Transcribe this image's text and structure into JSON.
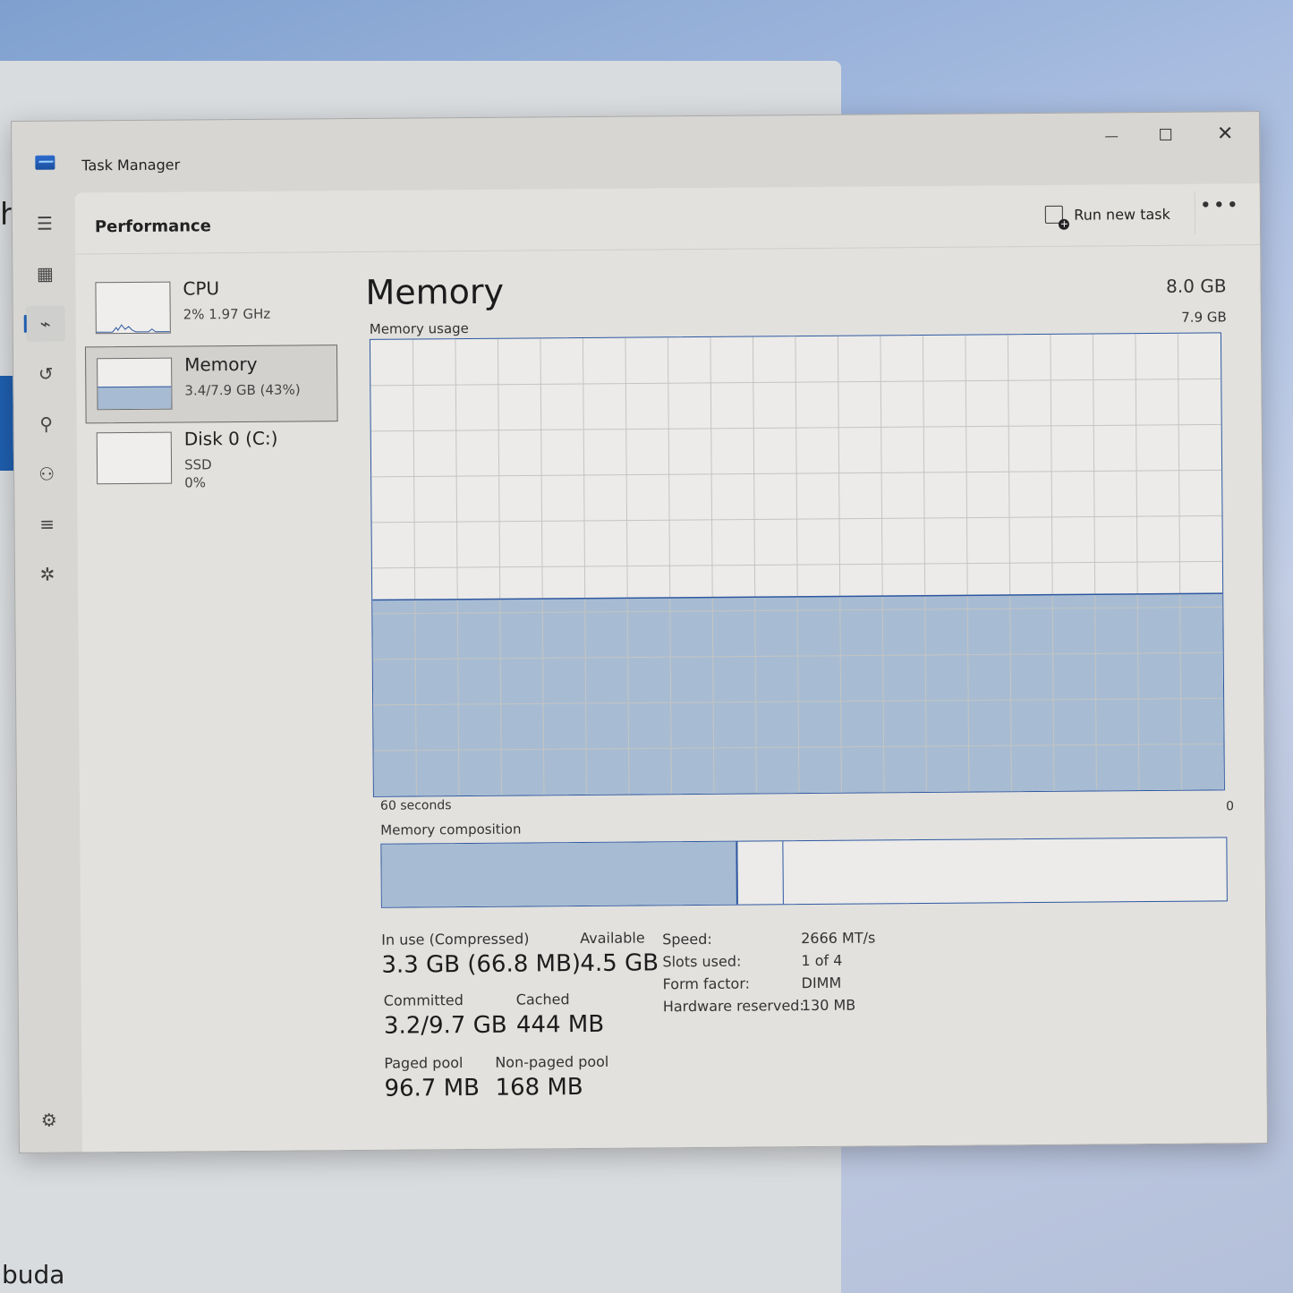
{
  "background": {
    "behind_window_text": "buda",
    "edge_glyph": "h"
  },
  "window": {
    "title": "Task Manager",
    "controls": {
      "minimize": "",
      "maximize": "",
      "close": "✕"
    }
  },
  "nav": {
    "menu_icon": "☰",
    "items": [
      {
        "name": "processes-icon",
        "glyph": "▦"
      },
      {
        "name": "performance-icon",
        "glyph": "⌁"
      },
      {
        "name": "app-history-icon",
        "glyph": "↺"
      },
      {
        "name": "startup-apps-icon",
        "glyph": "⚲"
      },
      {
        "name": "users-icon",
        "glyph": "⚇"
      },
      {
        "name": "details-icon",
        "glyph": "≡"
      },
      {
        "name": "services-icon",
        "glyph": "✲"
      }
    ],
    "settings_icon": "⚙"
  },
  "header": {
    "title": "Performance",
    "run_new_task": "Run new task",
    "more": "•••"
  },
  "devices": [
    {
      "name": "CPU",
      "line1": "2%  1.97 GHz"
    },
    {
      "name": "Memory",
      "line1": "3.4/7.9 GB (43%)"
    },
    {
      "name": "Disk 0 (C:)",
      "line1": "SSD",
      "line2": "0%"
    }
  ],
  "memory": {
    "title": "Memory",
    "total": "8.0 GB",
    "usage_label": "Memory usage",
    "usage_max": "7.9 GB",
    "time_left": "60 seconds",
    "time_right": "0",
    "usage_fraction": 0.43,
    "composition_label": "Memory composition",
    "composition": {
      "in_use_fraction": 0.42,
      "modified_fraction": 0.055
    },
    "stats": {
      "in_use_label": "In use (Compressed)",
      "in_use_value": "3.3 GB (66.8 MB)",
      "available_label": "Available",
      "available_value": "4.5 GB",
      "committed_label": "Committed",
      "committed_value": "3.2/9.7 GB",
      "cached_label": "Cached",
      "cached_value": "444 MB",
      "paged_label": "Paged pool",
      "paged_value": "96.7 MB",
      "nonpaged_label": "Non-paged pool",
      "nonpaged_value": "168 MB"
    },
    "hardware": {
      "speed_label": "Speed:",
      "speed_value": "2666 MT/s",
      "slots_label": "Slots used:",
      "slots_value": "1 of 4",
      "form_label": "Form factor:",
      "form_value": "DIMM",
      "reserved_label": "Hardware reserved:",
      "reserved_value": "130 MB"
    }
  },
  "colors": {
    "accent": "#1f5fb0",
    "graph_line": "#2e57a0",
    "graph_fill": "#a7bcd3"
  }
}
